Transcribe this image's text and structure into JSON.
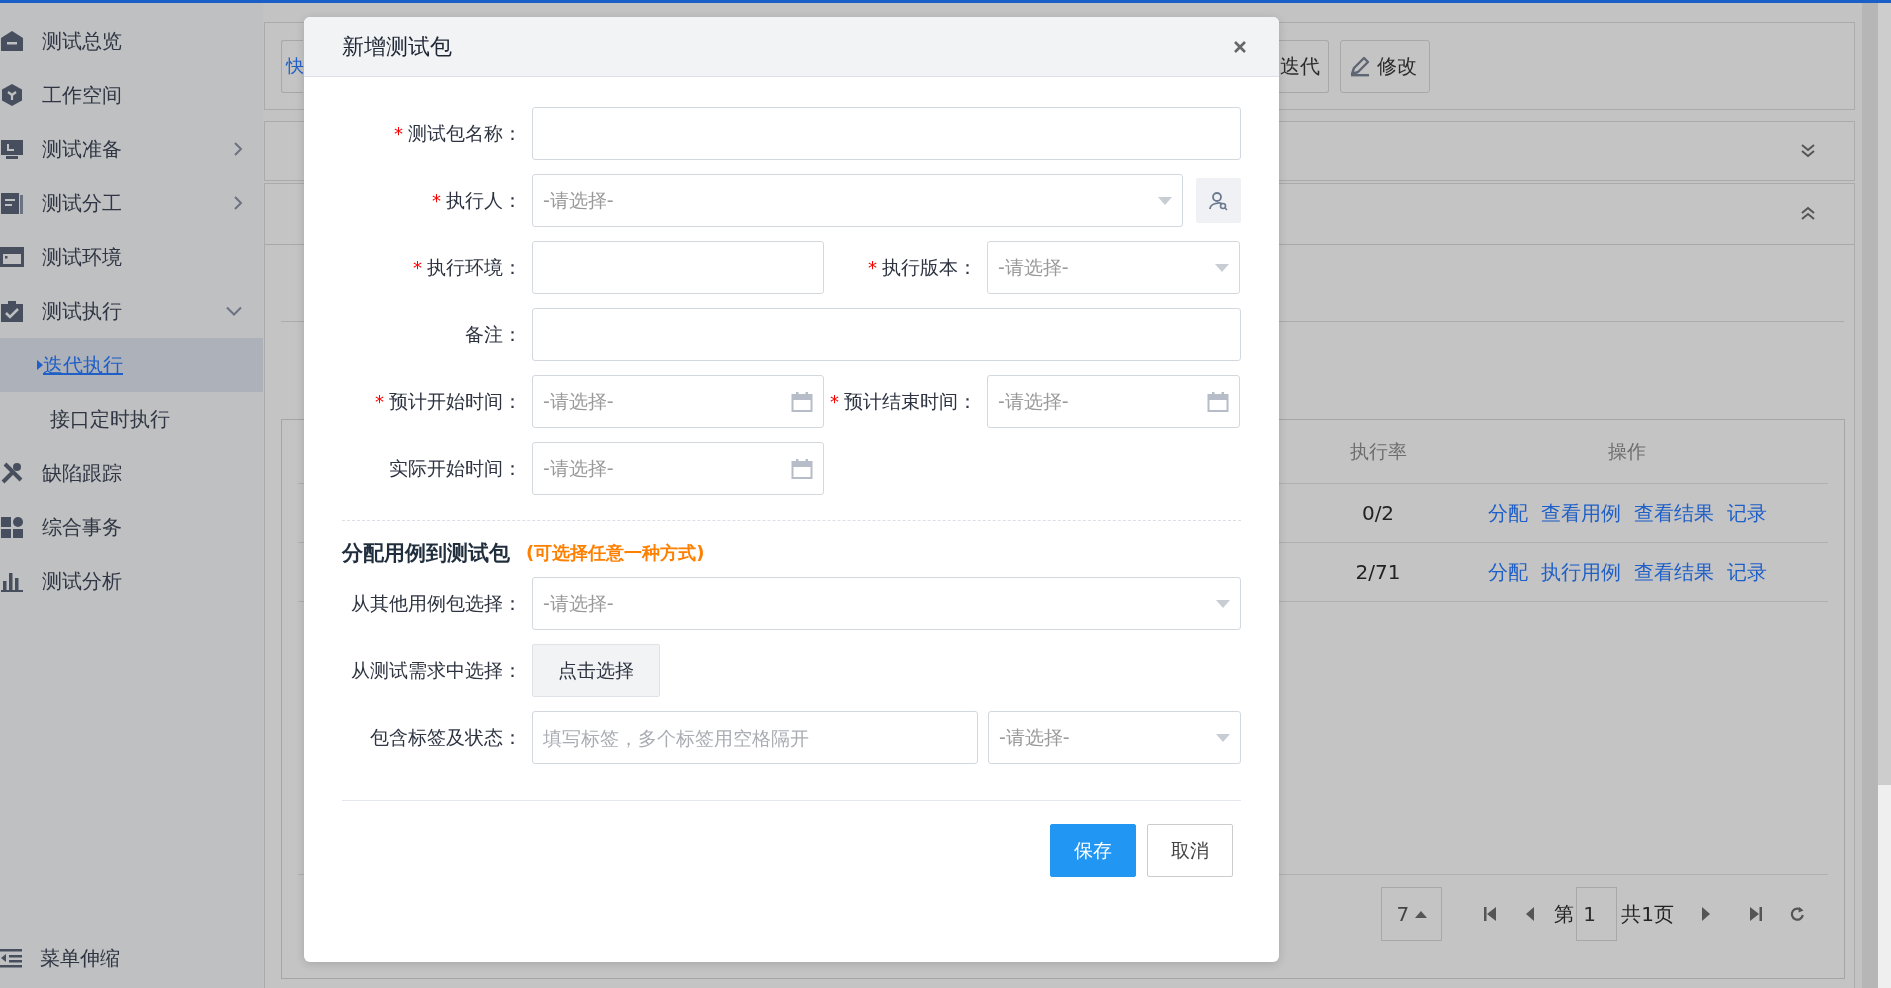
{
  "sidebar": {
    "items": [
      {
        "label": "测试总览"
      },
      {
        "label": "工作空间"
      },
      {
        "label": "测试准备",
        "expanded": false
      },
      {
        "label": "测试分工",
        "expanded": false
      },
      {
        "label": "测试环境"
      },
      {
        "label": "测试执行",
        "expanded": true,
        "children": [
          {
            "label": "迭代执行",
            "selected": true
          },
          {
            "label": "接口定时执行",
            "selected": false
          }
        ]
      },
      {
        "label": "缺陷跟踪"
      },
      {
        "label": "综合事务"
      },
      {
        "label": "测试分析"
      }
    ],
    "footer": "菜单伸缩"
  },
  "toolbar": {
    "buttons": [
      {
        "label": "快",
        "kind": "primary"
      },
      {
        "label": "迭代",
        "kind": "plain"
      },
      {
        "label": "修改",
        "kind": "edit"
      }
    ]
  },
  "table": {
    "columns": [
      "执行率",
      "操作"
    ],
    "rows": [
      {
        "rate": "0/2",
        "actions": [
          "分配",
          "查看用例",
          "查看结果",
          "记录"
        ]
      },
      {
        "rate": "2/71",
        "actions": [
          "分配",
          "执行用例",
          "查看结果",
          "记录"
        ]
      }
    ]
  },
  "pagination": {
    "page_size": "7",
    "page_label": "第",
    "page": "1",
    "total": "共1页"
  },
  "dialog": {
    "title": "新增测试包",
    "sections": [
      {
        "rows": [
          {
            "kind": "single",
            "fields": [
              {
                "required_mark": "*",
                "label": "测试包名称：",
                "kind": "text"
              }
            ]
          },
          {
            "kind": "picker",
            "fields": [
              {
                "required_mark": "*",
                "label": "执行人：",
                "kind": "select",
                "placeholder": "-请选择-"
              }
            ]
          },
          {
            "kind": "double",
            "fields": [
              {
                "required_mark": "*",
                "label": "执行环境：",
                "kind": "text"
              },
              {
                "required_mark": "*",
                "label": "执行版本：",
                "kind": "select",
                "placeholder": "-请选择-"
              }
            ]
          },
          {
            "kind": "single",
            "fields": [
              {
                "label": "备注：",
                "kind": "text"
              }
            ]
          },
          {
            "kind": "double",
            "fields": [
              {
                "required_mark": "*",
                "label": "预计开始时间：",
                "kind": "date",
                "placeholder": "-请选择-"
              },
              {
                "required_mark": "*",
                "label": "预计结束时间：",
                "kind": "date",
                "placeholder": "-请选择-"
              }
            ]
          },
          {
            "kind": "half",
            "fields": [
              {
                "label": "实际开始时间：",
                "kind": "date",
                "placeholder": "-请选择-"
              }
            ]
          }
        ]
      },
      {
        "title": "分配用例到测试包",
        "hint": "(可选择任意一种方式)",
        "rows": [
          {
            "kind": "single",
            "fields": [
              {
                "label": "从其他用例包选择：",
                "kind": "select",
                "placeholder": "-请选择-"
              }
            ]
          },
          {
            "kind": "button",
            "fields": [
              {
                "label": "从测试需求中选择：",
                "kind": "button",
                "value": "点击选择"
              }
            ]
          },
          {
            "kind": "pair",
            "fields": [
              {
                "label": "包含标签及状态：",
                "kind": "text",
                "placeholder": "填写标签，多个标签用空格隔开"
              },
              {
                "kind": "select",
                "placeholder": "-请选择-"
              }
            ]
          }
        ]
      }
    ],
    "buttons": [
      {
        "label": "保存",
        "kind": "primary"
      },
      {
        "label": "取消",
        "kind": "default"
      }
    ]
  }
}
